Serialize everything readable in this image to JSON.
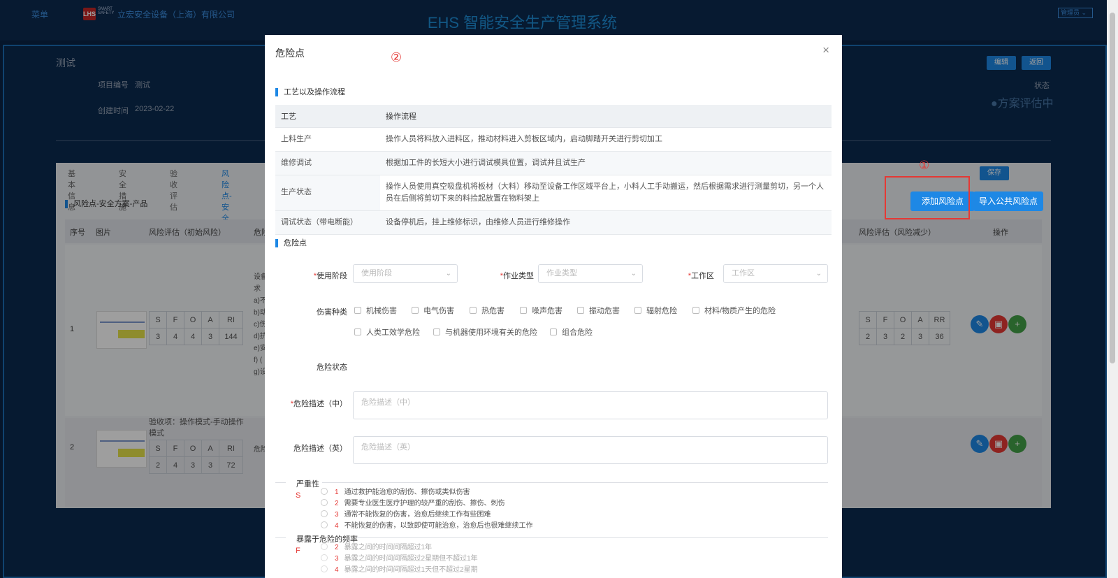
{
  "header": {
    "menu_label": "菜单",
    "logo_text": "LHS",
    "logo_sub": "SMART SAFETY",
    "company": "立宏安全设备（上海）有限公司",
    "system_title": "EHS 智能安全生产管理系统",
    "user_select": "管理员"
  },
  "project": {
    "title": "测试",
    "code_label": "项目编号",
    "code_value": "测试",
    "created_label": "创建时间",
    "created_value": "2023-02-22",
    "edit_label": "编辑",
    "back_label": "返回",
    "status_label": "状态",
    "status_value": "●方案评估中"
  },
  "tabs": [
    "基本信息",
    "安全措施",
    "验收评估",
    "风险点-安全方"
  ],
  "risk_section": {
    "title": "风险点-安全方案-产品",
    "save_label": "保存",
    "add_label": "添加风险点",
    "import_label": "导入公共风险点",
    "annotation_1": "①",
    "columns": [
      "序号",
      "图片",
      "风险评估（初始风险）",
      "危险",
      "风险评估（风险减少）",
      "操作"
    ],
    "rows": [
      {
        "index": "1",
        "initial_headers": [
          "S",
          "F",
          "O",
          "A",
          "RI"
        ],
        "initial_values": [
          "3",
          "4",
          "4",
          "3",
          "144"
        ],
        "desc_lines": [
          "设备",
          "求",
          "a)不",
          "b)动",
          "c)伤",
          "d)抗",
          "e)安",
          "f) (",
          "g)设"
        ],
        "reduced_headers": [
          "S",
          "F",
          "O",
          "A",
          "RR"
        ],
        "reduced_values": [
          "2",
          "3",
          "2",
          "3",
          "36"
        ]
      },
      {
        "index": "2",
        "accept_item": "验收项：操作模式-手动操作模式",
        "initial_headers": [
          "S",
          "F",
          "O",
          "A",
          "RI"
        ],
        "initial_values": [
          "2",
          "4",
          "3",
          "3",
          "72"
        ],
        "desc_short": "危险"
      }
    ]
  },
  "modal": {
    "title": "危险点",
    "annotation_2": "②",
    "close": "×",
    "process_section": "工艺以及操作流程",
    "process_table": {
      "headers": [
        "工艺",
        "操作流程"
      ],
      "rows": [
        [
          "上料生产",
          "操作人员将料放入进料区，推动材料进入剪板区域内，启动脚踏开关进行剪切加工"
        ],
        [
          "维修调试",
          "根据加工件的长短大小进行调试模具位置，调试并且试生产"
        ],
        [
          "生产状态",
          "操作人员使用真空吸盘机将板材（大料）移动至设备工作区域平台上，小料人工手动搬运，然后根据需求进行测量剪切，另一个人员在后侧将剪切下来的料捡起放置在物料架上"
        ],
        [
          "调试状态（带电断能）",
          "设备停机后，挂上维修标识，由维修人员进行维修操作"
        ]
      ]
    },
    "hazard_section": "危险点",
    "fields": {
      "stage_label": "使用阶段",
      "stage_placeholder": "使用阶段",
      "work_type_label": "作业类型",
      "work_type_placeholder": "作业类型",
      "work_area_label": "工作区",
      "work_area_placeholder": "工作区",
      "harm_type_label": "伤害种类",
      "harm_types": [
        "机械伤害",
        "电气伤害",
        "热危害",
        "噪声危害",
        "振动危害",
        "辐射危险",
        "材料/物质产生的危险",
        "人类工效学危险",
        "与机器使用环境有关的危险",
        "组合危险"
      ],
      "hazard_state_label": "危险状态",
      "desc_cn_label": "危险描述（中）",
      "desc_cn_placeholder": "危险描述（中）",
      "desc_en_label": "危险描述（英）",
      "desc_en_placeholder": "危险描述（英）"
    },
    "severity": {
      "title": "严重性",
      "letter": "S",
      "options": [
        {
          "num": "1",
          "text": "通过救护能治愈的刮伤、擦伤或类似伤害"
        },
        {
          "num": "2",
          "text": "需要专业医生医疗护理的较严重的刮伤、擦伤、刺伤"
        },
        {
          "num": "3",
          "text": "通常不能恢复的伤害，治愈后继续工作有些困难"
        },
        {
          "num": "4",
          "text": "不能恢复的伤害，以致即使可能治愈，治愈后也很难继续工作"
        }
      ]
    },
    "frequency": {
      "title": "暴露于危险的频率",
      "letter": "F",
      "options": [
        {
          "num": "2",
          "text": "暴露之间的时间间隔超过1年"
        },
        {
          "num": "3",
          "text": "暴露之间的时间间隔超过2星期但不超过1年"
        },
        {
          "num": "4",
          "text": "暴露之间的时间间隔超过1天但不超过2星期"
        }
      ]
    }
  },
  "colors": {
    "accent": "#1e88e5",
    "required": "#e53935",
    "header_bg": "#0c2a50"
  }
}
